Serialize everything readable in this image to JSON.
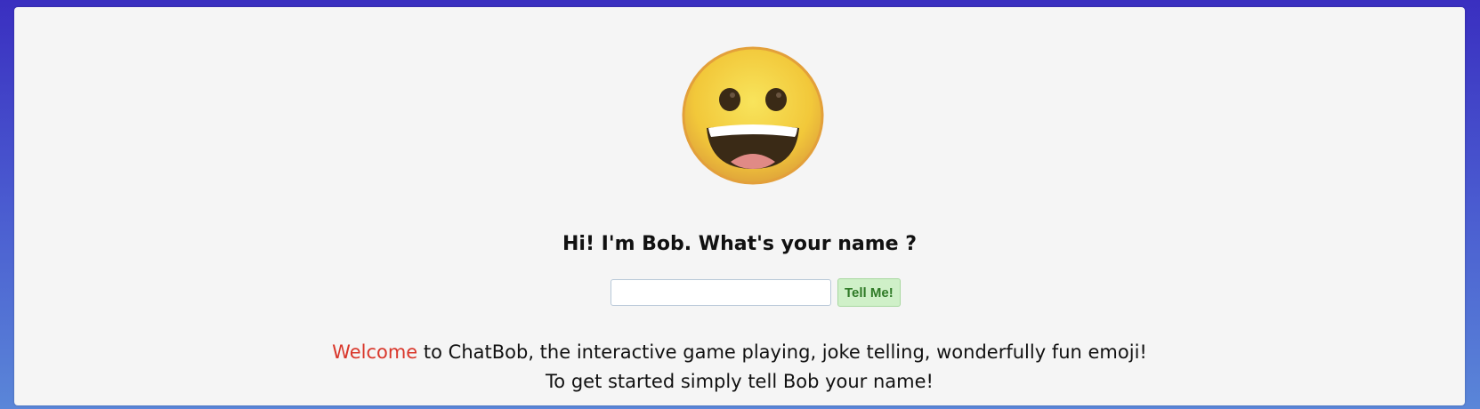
{
  "emoji": {
    "icon": "grinning-face-icon"
  },
  "heading": "Hi! I'm Bob. What's your name ?",
  "name_input": {
    "value": "",
    "placeholder": ""
  },
  "tell_button_label": "Tell Me!",
  "welcome": {
    "highlight": "Welcome",
    "rest": " to ChatBob, the interactive game playing, joke telling, wonderfully fun emoji!",
    "line2": "To get started simply tell Bob your name!"
  },
  "colors": {
    "accent": "#d9372b",
    "button_bg": "#cff0c8",
    "button_text": "#2f7a27",
    "background_top": "#3a2fc0",
    "background_bottom": "#5a86d8"
  }
}
